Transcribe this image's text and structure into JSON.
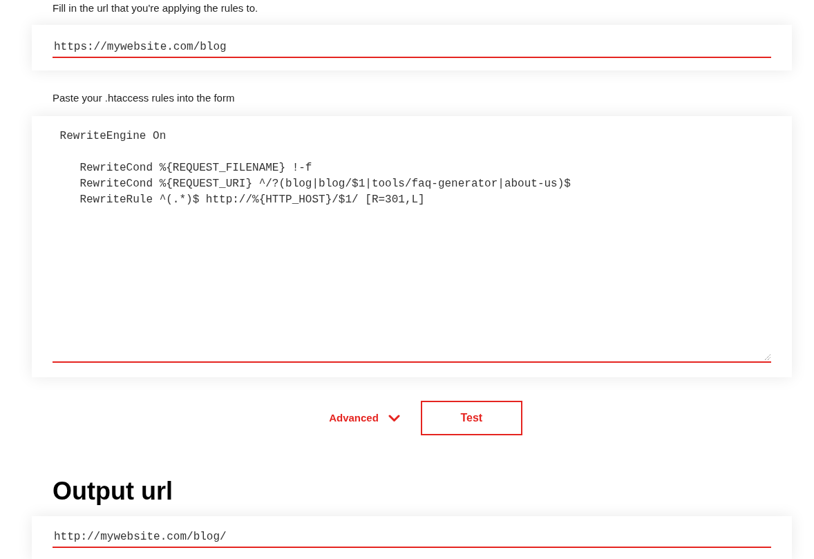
{
  "url_section": {
    "label": "Fill in the url that you're applying the rules to.",
    "url_field": {
      "value": "https://mywebsite.com/blog"
    }
  },
  "rules_section": {
    "label": "Paste your .htaccess rules into the form",
    "rules_field": {
      "value": " RewriteEngine On\n\n    RewriteCond %{REQUEST_FILENAME} !-f\n    RewriteCond %{REQUEST_URI} ^/?(blog|blog/$1|tools/faq-generator|about-us)$\n    RewriteRule ^(.*)$ http://%{HTTP_HOST}/$1/ [R=301,L]"
    }
  },
  "actions": {
    "advanced": {
      "label": "Advanced",
      "expanded": false
    },
    "test_button": {
      "label": "Test"
    }
  },
  "output": {
    "heading": "Output url",
    "url_field": {
      "value": "http://mywebsite.com/blog/"
    }
  }
}
